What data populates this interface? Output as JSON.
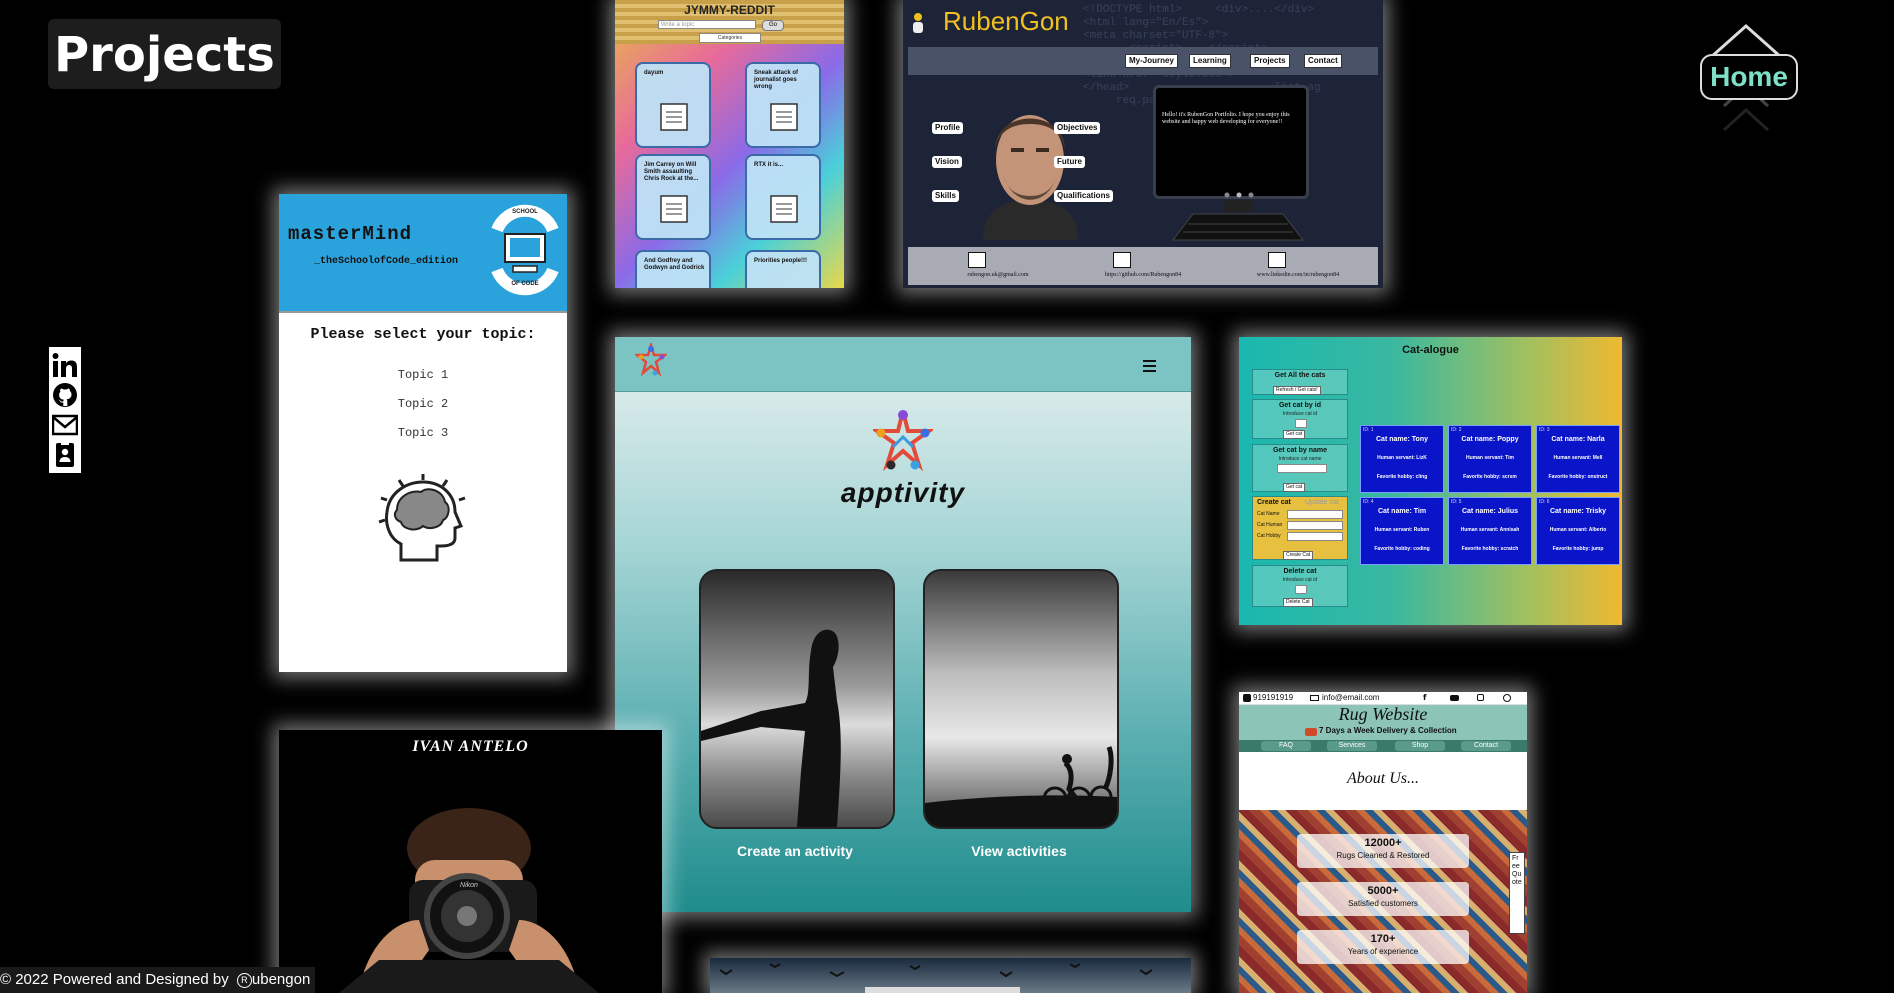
{
  "page": {
    "title": "Projects",
    "home_label": "Home",
    "footer": "© 2022 Powered and Designed by",
    "footer_brand": "ubengon",
    "footer_brand_mark": "R"
  },
  "socials": [
    {
      "name": "linkedin-icon"
    },
    {
      "name": "github-icon"
    },
    {
      "name": "email-icon"
    },
    {
      "name": "contact-card-icon"
    }
  ],
  "jymmy": {
    "title": "JYMMY-REDDIT",
    "search_placeholder": "Write a topic",
    "search_btn": "Go",
    "categories": "Categories",
    "posts": [
      {
        "title": "dayum"
      },
      {
        "title": "Sneak attack of journalist goes wrong"
      },
      {
        "title": "Jim Carrey on Will Smith assaulting Chris Rock at the..."
      },
      {
        "title": "RTX it is..."
      },
      {
        "title": "And Godfrey and Godwyn and Godrick"
      },
      {
        "title": "Priorities people!!!"
      }
    ]
  },
  "rubengon": {
    "brand": "RubenGon",
    "nav": [
      "My-Journey",
      "Learning",
      "Projects",
      "Contact"
    ],
    "left_btns": [
      "Profile",
      "Vision",
      "Skills"
    ],
    "right_btns": [
      "Objectives",
      "Future",
      "Qualifications"
    ],
    "screen_text": "Hello! it's RubenGon Portfolio. I hope you enjoy this website and happy web developing for everyone!!",
    "contacts": [
      "rubengon.uk@gmail.com",
      "https://github.com/Rubengon84",
      "www.linkedin.com/in/rubengon84"
    ]
  },
  "mastermind": {
    "title": "masterMind",
    "subtitle": "_theSchoolofCode_edition",
    "badge_top": "SCHOOL",
    "badge_bottom": "OF CODE",
    "prompt": "Please select your topic:",
    "topics": [
      "Topic 1",
      "Topic 2",
      "Topic 3"
    ]
  },
  "apptivity": {
    "logo_text": "apptivity",
    "btn_create": "Create an activity",
    "btn_view": "View activities"
  },
  "catalogue": {
    "title": "Cat-alogue",
    "panels": [
      {
        "title": "Get All the cats",
        "button": "Refresh / Get cats!"
      },
      {
        "title": "Get cat by id",
        "hint": "Introduce cat id",
        "button": "Get cat"
      },
      {
        "title": "Get cat by name",
        "hint": "Introduce cat name",
        "button": "Get cat"
      },
      {
        "title": "Create cat",
        "alt": "Update cat",
        "fields": [
          "Cat Name",
          "Cat Human",
          "Cat Hobby"
        ],
        "button": "Create Cat"
      },
      {
        "title": "Delete cat",
        "hint": "Introduce cat id",
        "button": "Delete Cat"
      }
    ],
    "cats": [
      {
        "id": "ID: 1",
        "name": "Cat name: Tony",
        "human": "Human servant: LizK",
        "hobby": "Favorite hobby: cling"
      },
      {
        "id": "ID: 2",
        "name": "Cat name: Poppy",
        "human": "Human servant: Tim",
        "hobby": "Favorite hobby: scrsm"
      },
      {
        "id": "ID: 3",
        "name": "Cat name: Narla",
        "human": "Human servant: Mell",
        "hobby": "Favorite hobby: onstruct"
      },
      {
        "id": "ID: 4",
        "name": "Cat name: Tim",
        "human": "Human servant: Ruben",
        "hobby": "Favorite hobby: coding"
      },
      {
        "id": "ID: 5",
        "name": "Cat name: Julius",
        "human": "Human servant: Annisah",
        "hobby": "Favorite hobby: scratch"
      },
      {
        "id": "ID: 6",
        "name": "Cat name: Trisky",
        "human": "Human servant: Alberto",
        "hobby": "Favorite hobby: jump"
      }
    ]
  },
  "ivan": {
    "title": "IVAN ANTELO",
    "camera_brand": "Nikon"
  },
  "rug": {
    "phone": "919191919",
    "email": "info@email.com",
    "title": "Rug Website",
    "tagline": "7 Days a Week Delivery & Collection",
    "nav": [
      "FAQ",
      "Services",
      "Shop",
      "Contact"
    ],
    "about": "About Us...",
    "stats": [
      {
        "num": "12000+",
        "label": "Rugs Cleaned & Restored"
      },
      {
        "num": "5000+",
        "label": "Satisfied customers"
      },
      {
        "num": "170+",
        "label": "Years of experience"
      }
    ],
    "side_tab": "Free Quote"
  },
  "colors": {
    "accent_home": "#7fe0c8",
    "mastermind_blue": "#2aa3dd",
    "cat_blue": "#0a14c8",
    "apptivity_teal": "#1f8c8c"
  }
}
